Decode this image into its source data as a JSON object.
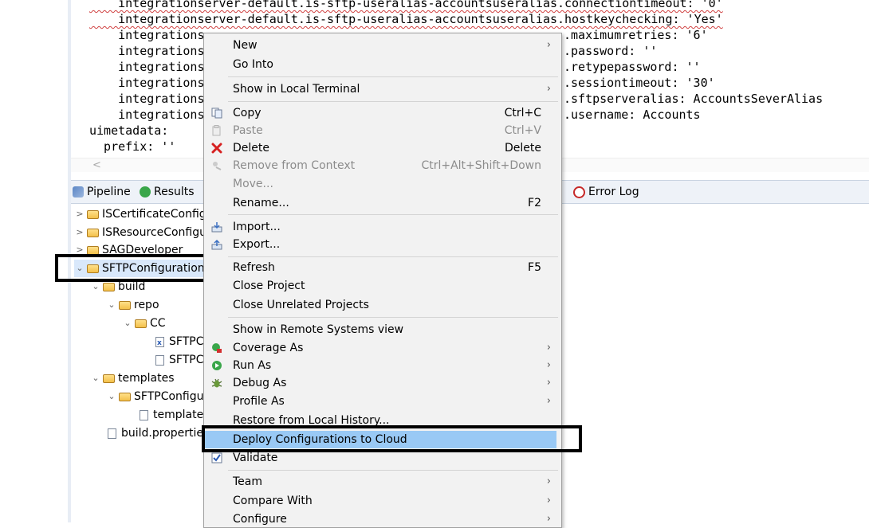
{
  "editor": {
    "lines": [
      "    integrationserver-default.is-sftp-useralias-accountsuseralias.connectiontimeout: '0'",
      "    integrationserver-default.is-sftp-useralias-accountsuseralias.hostkeychecking: 'Yes'",
      "    integrations",
      "    integrations",
      "    integrations",
      "    integrations",
      "    integrations",
      "    integrations",
      "uimetadata:",
      "  prefix: ''"
    ],
    "line_tails": [
      "",
      "",
      ".maximumretries: '6'",
      ".password: ''",
      ".retypepassword: ''",
      ".sessiontimeout: '30'",
      ".sftpserveralias: AccountsSeverAlias",
      ".username: Accounts",
      "",
      ""
    ],
    "scroll_left_glyph": "<"
  },
  "panel_tabs": [
    {
      "label": "Pipeline",
      "icon": "pipeline-icon"
    },
    {
      "label": "Results",
      "icon": "results-icon"
    },
    {
      "label": "Error Log",
      "icon": "error-log-icon"
    }
  ],
  "tree": {
    "items": [
      {
        "label": "ISCertificateConfig",
        "expanded": false
      },
      {
        "label": "ISResourceConfigu",
        "expanded": false
      },
      {
        "label": "SAGDeveloper",
        "expanded": false
      },
      {
        "label": "SFTPConfiguration",
        "expanded": true,
        "selected": true
      },
      {
        "label": "build",
        "expanded": true
      },
      {
        "label": "repo",
        "expanded": true
      },
      {
        "label": "CC",
        "expanded": true
      },
      {
        "label": "SFTPC",
        "file": "xml"
      },
      {
        "label": "SFTPC",
        "file": "text"
      },
      {
        "label": "templates",
        "expanded": true
      },
      {
        "label": "SFTPConfigu",
        "expanded": true
      },
      {
        "label": "template",
        "file": "text"
      },
      {
        "label": "build.propertie",
        "file": "binary"
      }
    ]
  },
  "context_menu": {
    "items": [
      {
        "label": "New",
        "submenu": true
      },
      {
        "label": "Go Into"
      },
      {
        "label": "Show in Local Terminal",
        "submenu": true
      },
      {
        "label": "Copy",
        "accel": "Ctrl+C",
        "icon": "copy-icon"
      },
      {
        "label": "Paste",
        "accel": "Ctrl+V",
        "icon": "paste-icon",
        "disabled": true
      },
      {
        "label": "Delete",
        "accel": "Delete",
        "icon": "delete-icon"
      },
      {
        "label": "Remove from Context",
        "accel": "Ctrl+Alt+Shift+Down",
        "icon": "remove-context-icon",
        "disabled": true
      },
      {
        "label": "Move...",
        "disabled": true
      },
      {
        "label": "Rename...",
        "accel": "F2"
      },
      {
        "label": "Import...",
        "icon": "import-icon"
      },
      {
        "label": "Export...",
        "icon": "export-icon"
      },
      {
        "label": "Refresh",
        "accel": "F5"
      },
      {
        "label": "Close Project"
      },
      {
        "label": "Close Unrelated Projects"
      },
      {
        "label": "Show in Remote Systems view"
      },
      {
        "label": "Coverage As",
        "submenu": true,
        "icon": "coverage-icon"
      },
      {
        "label": "Run As",
        "submenu": true,
        "icon": "run-icon"
      },
      {
        "label": "Debug As",
        "submenu": true,
        "icon": "debug-icon"
      },
      {
        "label": "Profile As",
        "submenu": true
      },
      {
        "label": "Restore from Local History..."
      },
      {
        "label": "Deploy Configurations to Cloud",
        "highlighted": true
      },
      {
        "label": "Validate",
        "icon": "checkbox-icon"
      },
      {
        "label": "Team",
        "submenu": true
      },
      {
        "label": "Compare With",
        "submenu": true
      },
      {
        "label": "Configure",
        "submenu": true
      }
    ],
    "submenu_glyph": "›"
  },
  "colors": {
    "menu_bg": "#f2f2f2",
    "menu_highlight": "#99c9f5",
    "tab_bar": "#eef2f8",
    "selection": "#d9e8fb",
    "annotation_box": "#000000"
  }
}
